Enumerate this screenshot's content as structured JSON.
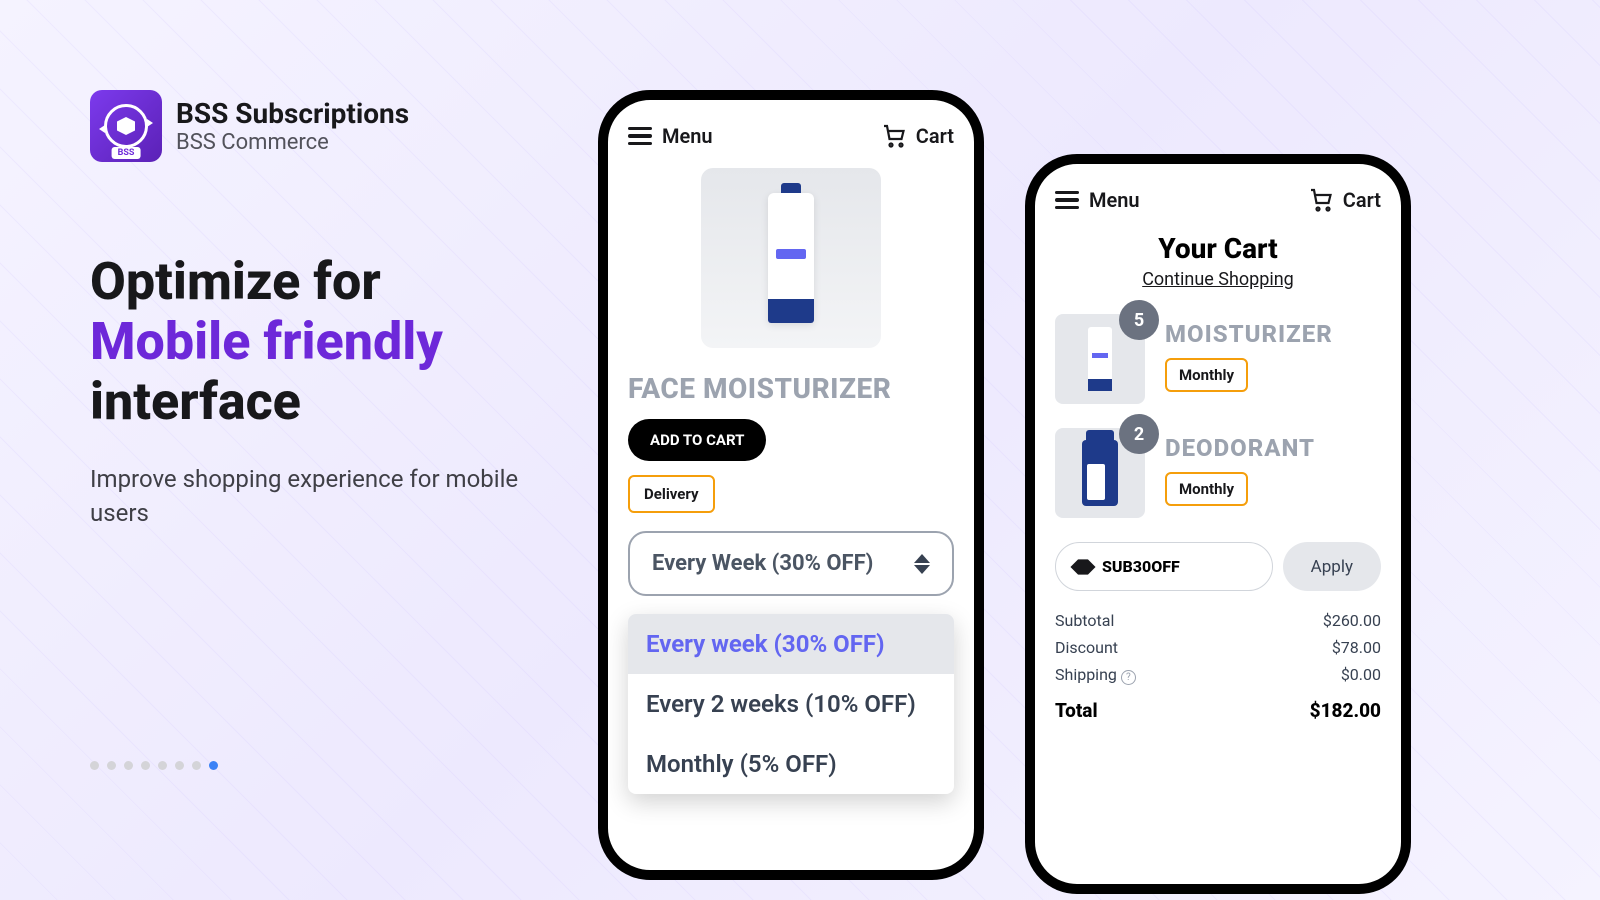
{
  "brand": {
    "title": "BSS Subscriptions",
    "subtitle": "BSS Commerce",
    "logo_label": "BSS"
  },
  "headline": {
    "line1": "Optimize for",
    "accent": "Mobile friendly",
    "line3": "interface"
  },
  "subtext": "Improve shopping experience for mobile users",
  "phone": {
    "menu": "Menu",
    "cart": "Cart"
  },
  "product": {
    "title": "FACE MOISTURIZER",
    "add_to_cart": "ADD TO CART",
    "delivery_label": "Delivery",
    "selected_frequency": "Every Week (30% OFF)",
    "frequency_options": [
      "Every week (30% OFF)",
      "Every 2 weeks (10% OFF)",
      "Monthly (5% OFF)"
    ]
  },
  "cart_page": {
    "title": "Your Cart",
    "continue": "Continue Shopping",
    "items": [
      {
        "name": "MOISTURIZER",
        "qty": "5",
        "badge": "Monthly"
      },
      {
        "name": "DEODORANT",
        "qty": "2",
        "badge": "Monthly"
      }
    ],
    "coupon": "SUB30OFF",
    "apply": "Apply",
    "subtotal_label": "Subtotal",
    "subtotal_value": "$260.00",
    "discount_label": "Discount",
    "discount_value": "$78.00",
    "shipping_label": "Shipping",
    "shipping_value": "$0.00",
    "total_label": "Total",
    "total_value": "$182.00"
  },
  "carousel": {
    "total": 8,
    "active_index": 7
  }
}
